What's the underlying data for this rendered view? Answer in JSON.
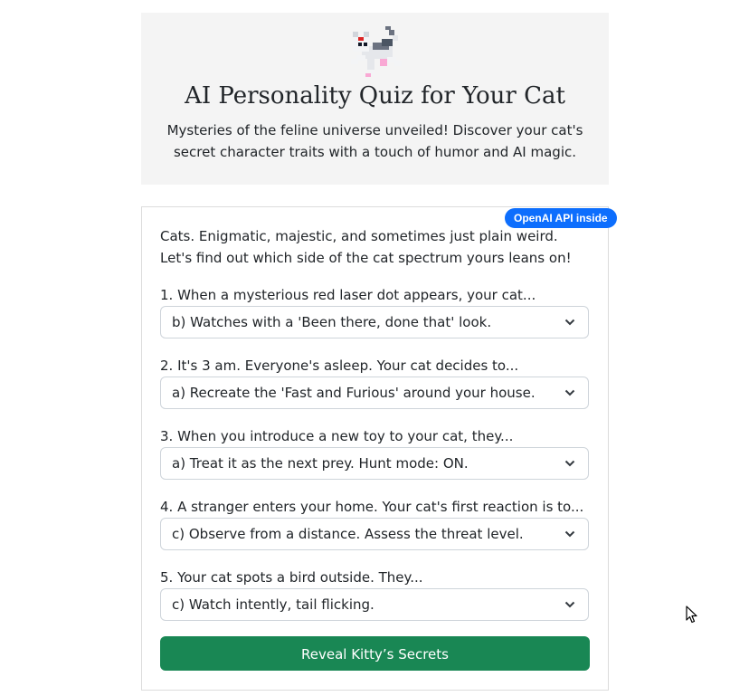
{
  "header": {
    "logo_icon": "pixel-cat-icon",
    "title": "AI Personality Quiz for Your Cat",
    "subtitle": "Mysteries of the feline universe unveiled! Discover your cat's secret character traits with a touch of humor and AI magic."
  },
  "card": {
    "badge": "OpenAI API inside",
    "intro": "Cats. Enigmatic, majestic, and sometimes just plain weird. Let's find out which side of the cat spectrum yours leans on!",
    "questions": [
      {
        "label": "1. When a mysterious red laser dot appears, your cat...",
        "selected": "b) Watches with a 'Been there, done that' look."
      },
      {
        "label": "2. It's 3 am. Everyone's asleep. Your cat decides to...",
        "selected": "a) Recreate the 'Fast and Furious' around your house."
      },
      {
        "label": "3. When you introduce a new toy to your cat, they...",
        "selected": "a) Treat it as the next prey. Hunt mode: ON."
      },
      {
        "label": "4. A stranger enters your home. Your cat's first reaction is to...",
        "selected": "c) Observe from a distance. Assess the threat level."
      },
      {
        "label": "5. Your cat spots a bird outside. They...",
        "selected": "c) Watch intently, tail flicking."
      }
    ],
    "submit_label": "Reveal Kitty’s Secrets"
  },
  "colors": {
    "header_bg": "#f4f4f4",
    "badge_bg": "#0d6efd",
    "submit_bg": "#198754"
  }
}
